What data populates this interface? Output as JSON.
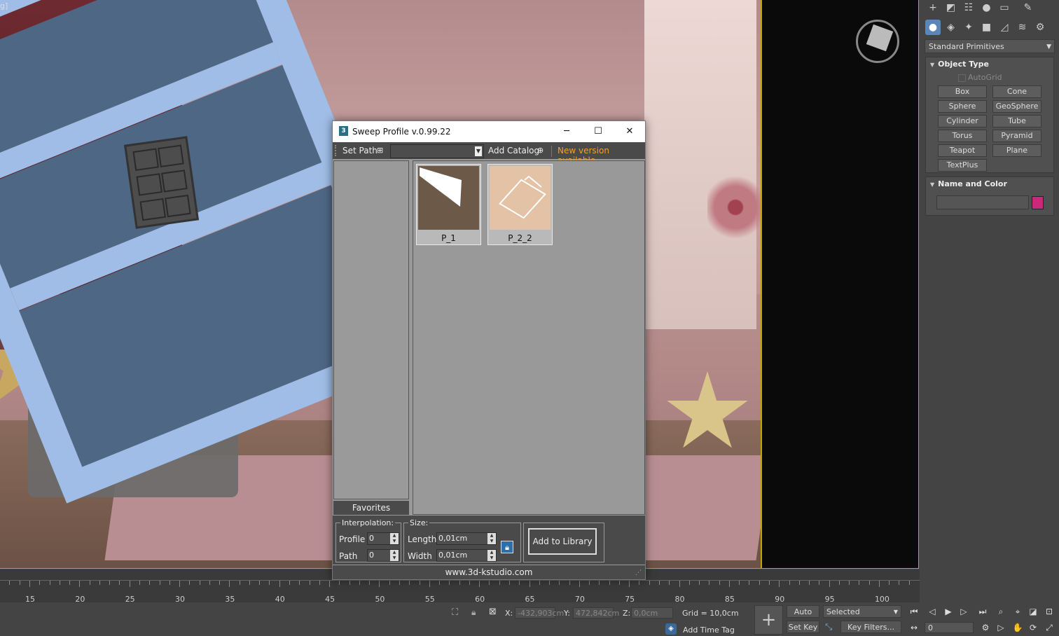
{
  "viewport": {
    "label": "g]"
  },
  "dialog": {
    "title": "Sweep Profile v.0.99.22",
    "app_icon": "3",
    "toolbar": {
      "set_path": "Set Path",
      "path_value": "",
      "add_catalog": "Add Catalog",
      "new_version": "New version available"
    },
    "favorites": "Favorites",
    "profiles": [
      {
        "name": "P_1"
      },
      {
        "name": "P_2_2"
      }
    ],
    "interpolation": {
      "legend": "Interpolation:",
      "profile_label": "Profile",
      "profile_value": "0",
      "path_label": "Path",
      "path_value": "0"
    },
    "size": {
      "legend": "Size:",
      "length_label": "Length:",
      "length_value": "0,01cm",
      "width_label": "Width",
      "width_value": "0,01cm"
    },
    "add_to_library": "Add to Library",
    "footer": "www.3d-kstudio.com"
  },
  "command_panel": {
    "category": "Standard Primitives",
    "object_type": {
      "title": "Object Type",
      "autogrid": "AutoGrid",
      "buttons": [
        "Box",
        "Cone",
        "Sphere",
        "GeoSphere",
        "Cylinder",
        "Tube",
        "Torus",
        "Pyramid",
        "Teapot",
        "Plane",
        "TextPlus"
      ]
    },
    "name_and_color": {
      "title": "Name and Color",
      "name_value": "",
      "color": "#c72a7a"
    }
  },
  "timeline": {
    "ticks": [
      "15",
      "20",
      "25",
      "30",
      "35",
      "40",
      "45",
      "50",
      "55",
      "60",
      "65",
      "70",
      "75",
      "80",
      "85",
      "90",
      "95",
      "100"
    ]
  },
  "status": {
    "x_label": "X:",
    "x_value": "-432,903cm",
    "y_label": "Y:",
    "y_value": "472,842cm",
    "z_label": "Z:",
    "z_value": "0,0cm",
    "grid": "Grid = 10,0cm",
    "add_time_tag": "Add Time Tag",
    "auto_key": "Auto Key",
    "set_key": "Set Key",
    "selected": "Selected",
    "key_filters": "Key Filters...",
    "frame": "0"
  }
}
